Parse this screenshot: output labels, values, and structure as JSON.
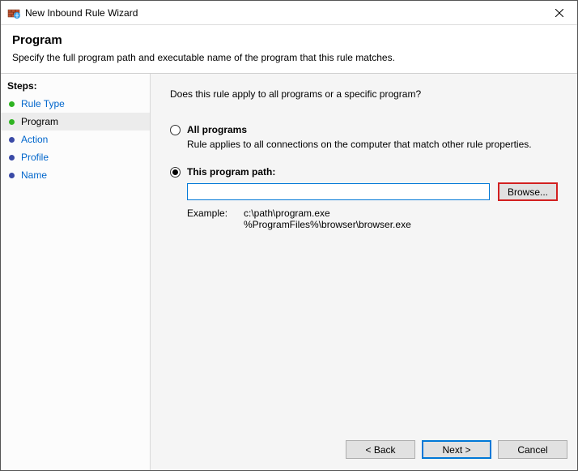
{
  "window": {
    "title": "New Inbound Rule Wizard"
  },
  "header": {
    "title": "Program",
    "subtitle": "Specify the full program path and executable name of the program that this rule matches."
  },
  "sidebar": {
    "label": "Steps:",
    "steps": [
      {
        "label": "Rule Type",
        "state": "completed"
      },
      {
        "label": "Program",
        "state": "current"
      },
      {
        "label": "Action",
        "state": "pending"
      },
      {
        "label": "Profile",
        "state": "pending"
      },
      {
        "label": "Name",
        "state": "pending"
      }
    ]
  },
  "main": {
    "question": "Does this rule apply to all programs or a specific program?",
    "options": {
      "all": {
        "label": "All programs",
        "description": "Rule applies to all connections on the computer that match other rule properties.",
        "selected": false
      },
      "path": {
        "label": "This program path:",
        "selected": true,
        "value": "",
        "browse_label": "Browse...",
        "example_label": "Example:",
        "example_text": "c:\\path\\program.exe\n%ProgramFiles%\\browser\\browser.exe"
      }
    }
  },
  "footer": {
    "back": "< Back",
    "next": "Next >",
    "cancel": "Cancel"
  }
}
